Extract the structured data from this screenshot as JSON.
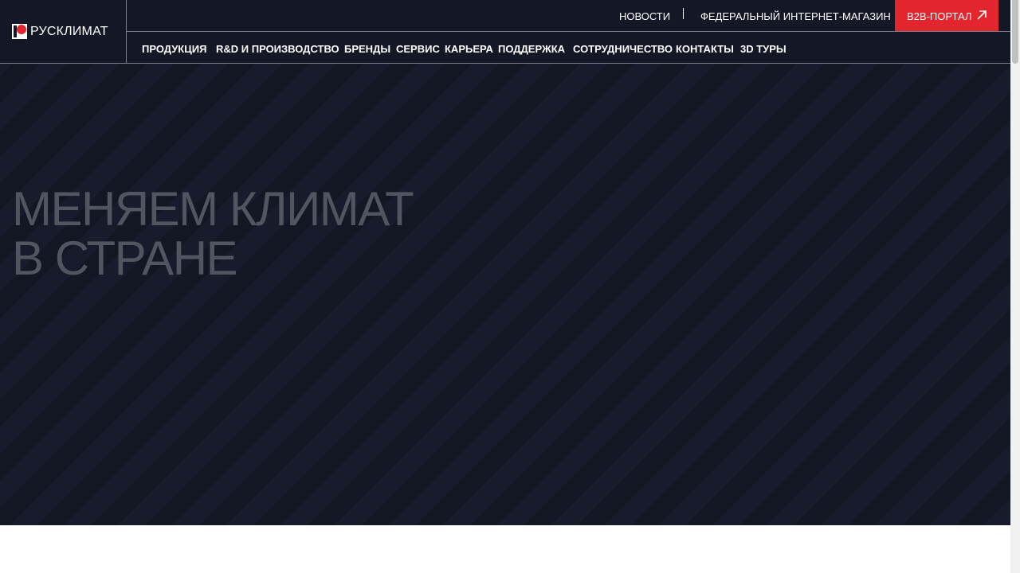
{
  "header": {
    "logo_text": "РУСКЛИМАТ",
    "top_links": {
      "news": "НОВОСТИ",
      "shop": "ФЕДЕРАЛЬНЫЙ ИНТЕРНЕТ-МАГАЗИН"
    },
    "b2b_button": {
      "label": "B2B-ПОРТАЛ",
      "icon": "arrow-up-right-icon"
    },
    "nav": [
      {
        "label": "ПРОДУКЦИЯ"
      },
      {
        "label": "R&D И ПРОИЗВОДСТВО"
      },
      {
        "label": "БРЕНДЫ"
      },
      {
        "label": "СЕРВИС"
      },
      {
        "label": "КАРЬЕРА"
      },
      {
        "label": "ПОДДЕРЖКА"
      },
      {
        "label": "СОТРУДНИЧЕСТВО"
      },
      {
        "label": "КОНТАКТЫ"
      },
      {
        "label": "3D ТУРЫ"
      }
    ]
  },
  "hero": {
    "headline_line1": "МЕНЯЕМ КЛИМАТ",
    "headline_line2": "В СТРАНЕ"
  },
  "colors": {
    "brand_red": "#e3262d",
    "header_bg": "#131726",
    "headline": "#52555f"
  }
}
